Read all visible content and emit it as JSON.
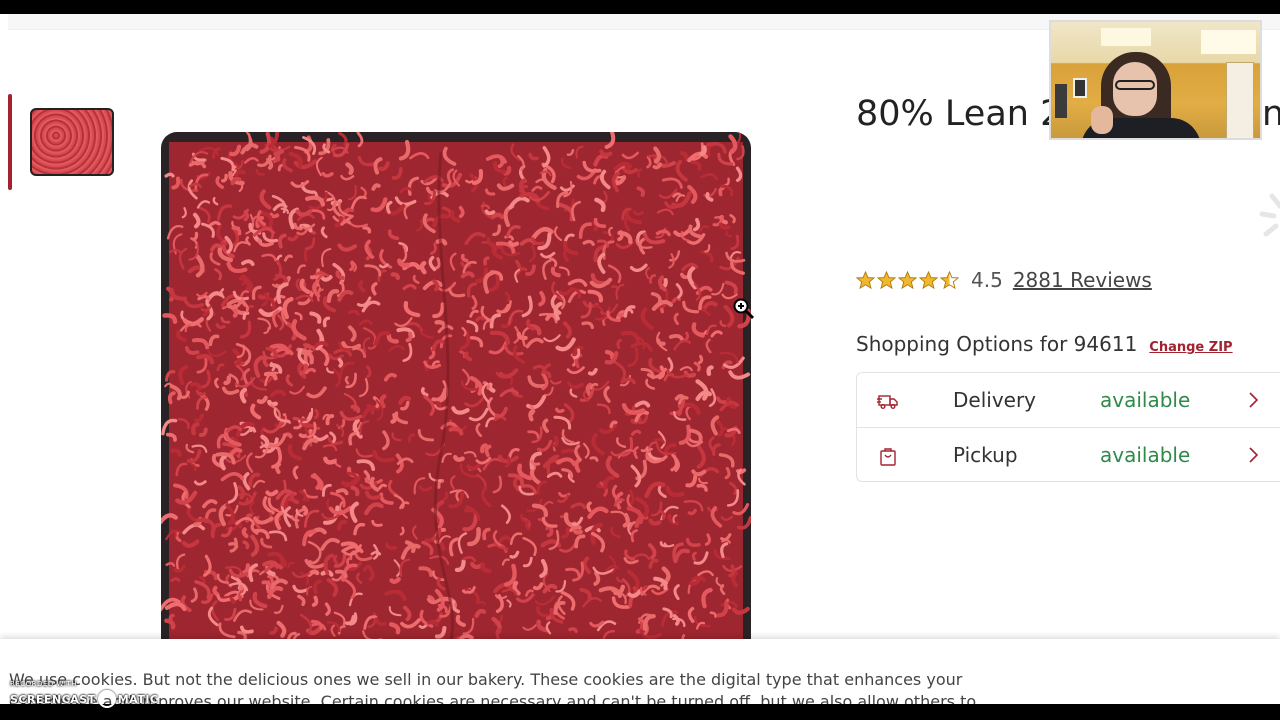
{
  "product": {
    "title": "80% Lean 2",
    "title_tail": "n",
    "image_alt": "ground beef in tray",
    "rating": "4.5",
    "star_count": 4.5,
    "reviews": "2881 Reviews"
  },
  "shopping": {
    "label": "Shopping Options for 94611",
    "change_zip": "Change ZIP",
    "options": [
      {
        "label": "Delivery",
        "status": "available",
        "icon": "delivery-truck-icon"
      },
      {
        "label": "Pickup",
        "status": "available",
        "icon": "shopping-bag-icon"
      }
    ]
  },
  "cookie": {
    "line1": "We use cookies. But not the delicious ones we sell in our bakery. These cookies are the digital type that enhances your",
    "line2": "experience and improves our website. Certain cookies are necessary and can't be turned off, but we also allow others to"
  },
  "watermark": {
    "small": "RECORDED WITH",
    "big_left": "SCREENCAST",
    "big_right": "MATIC"
  },
  "colors": {
    "brand": "#a3222f",
    "available": "#2f8a4a",
    "star": "#f1b82d"
  }
}
